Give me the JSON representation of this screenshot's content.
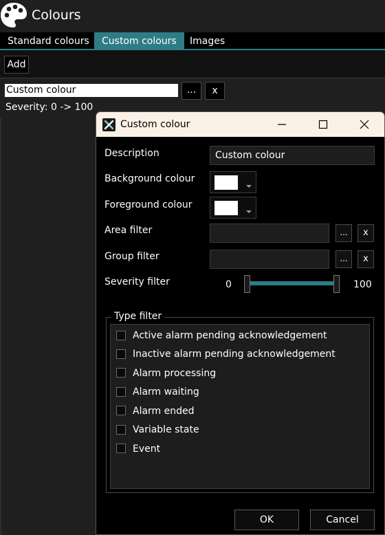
{
  "app": {
    "title": "Colours"
  },
  "tabs": [
    {
      "label": "Standard colours",
      "active": false
    },
    {
      "label": "Custom colours",
      "active": true
    },
    {
      "label": "Images",
      "active": false
    }
  ],
  "toolbar": {
    "add_label": "Add"
  },
  "list": {
    "item_name": "Custom colour",
    "browse_label": "...",
    "remove_label": "x",
    "severity_text": "Severity: 0 -> 100"
  },
  "dialog": {
    "title": "Custom colour",
    "description_label": "Description",
    "description_value": "Custom colour",
    "background_label": "Background colour",
    "foreground_label": "Foreground colour",
    "background_color": "#ffffff",
    "foreground_color": "#ffffff",
    "area_filter_label": "Area filter",
    "group_filter_label": "Group filter",
    "browse_label": "...",
    "clear_label": "x",
    "severity_label": "Severity filter",
    "severity_min": "0",
    "severity_max": "100",
    "type_filter_label": "Type filter",
    "type_options": [
      "Active alarm pending acknowledgement",
      "Inactive alarm pending acknowledgement",
      "Alarm processing",
      "Alarm waiting",
      "Alarm ended",
      "Variable state",
      "Event"
    ],
    "ok_label": "OK",
    "cancel_label": "Cancel"
  },
  "colors": {
    "accent": "#2e7d86",
    "dialog_title_bg": "#fbf1e6"
  },
  "icons": [
    "palette-icon",
    "tools-icon",
    "minimize-icon",
    "maximize-icon",
    "close-icon",
    "dropdown-arrow-icon"
  ]
}
